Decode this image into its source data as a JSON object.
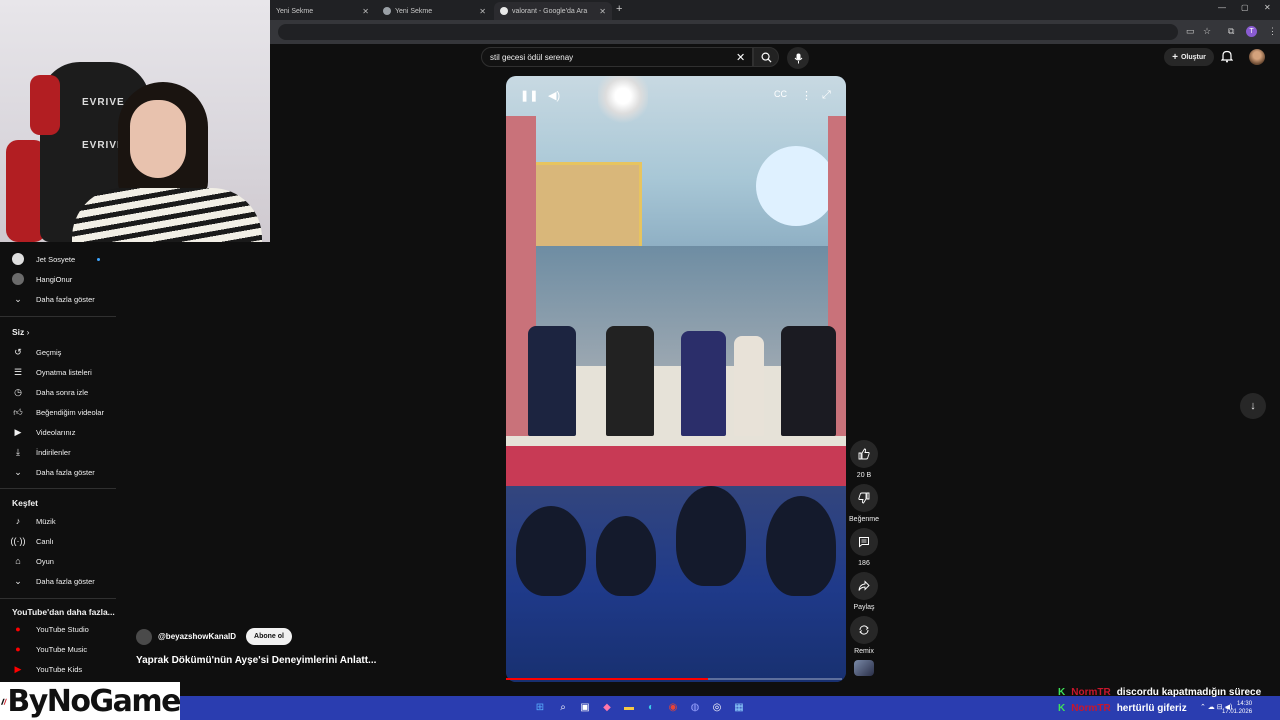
{
  "browser": {
    "tabs": [
      {
        "title": "Yeni Sekme"
      },
      {
        "title": "Yeni Sekme"
      },
      {
        "title": "valorant - Google'da Ara"
      }
    ],
    "new_tab_icon": "+",
    "profile_initial": "T"
  },
  "header": {
    "search_query": "stil gecesi ödül serenay",
    "create_label": "Oluştur"
  },
  "sidebar": {
    "subscriptions": [
      {
        "label": "Jet Sosyete",
        "has_dot": true
      },
      {
        "label": "HangiOnur",
        "has_dot": false
      }
    ],
    "show_more_1": "Daha fazla göster",
    "you_heading": "Siz",
    "you_items": [
      {
        "label": "Geçmiş",
        "icon": "history-icon"
      },
      {
        "label": "Oynatma listeleri",
        "icon": "playlist-icon"
      },
      {
        "label": "Daha sonra izle",
        "icon": "clock-icon"
      },
      {
        "label": "Beğendiğim videolar",
        "icon": "thumbs-up-icon"
      },
      {
        "label": "Videolarınız",
        "icon": "video-icon"
      },
      {
        "label": "İndirilenler",
        "icon": "download-icon"
      }
    ],
    "show_more_2": "Daha fazla göster",
    "explore_heading": "Keşfet",
    "explore_items": [
      {
        "label": "Müzik",
        "icon": "music-icon"
      },
      {
        "label": "Canlı",
        "icon": "live-icon"
      },
      {
        "label": "Oyun",
        "icon": "gamepad-icon"
      }
    ],
    "show_more_3": "Daha fazla göster",
    "more_from_heading": "YouTube'dan daha fazla...",
    "more_from_items": [
      {
        "label": "YouTube Studio"
      },
      {
        "label": "YouTube Music"
      },
      {
        "label": "YouTube Kids"
      }
    ]
  },
  "short": {
    "channel": "@beyazshowKanalD",
    "subscribe_label": "Abone ol",
    "title": "Yaprak Dökümü'nün Ayşe'si Deneyimlerini Anlatt...",
    "progress": 0.6,
    "likes": "20 B",
    "dislike_label": "Beğenme",
    "comments": "186",
    "share_label": "Paylaş",
    "remix_label": "Remix"
  },
  "overlay": {
    "logo_text": "ByNoGame",
    "webcam_chair_brand": "EVRIVE",
    "chat": [
      {
        "user": "NormTR",
        "message": "discordu kapatmadığın sürece"
      },
      {
        "user": "NormTR",
        "message": "hertürlü giferiz"
      }
    ]
  },
  "taskbar": {
    "time": "14:30",
    "date": "17.01.2026"
  },
  "colors": {
    "yt_bg": "#0f0f0f",
    "accent_red": "#ff0000",
    "taskbar": "#2a3db0",
    "chat_user": "#c8162c",
    "chat_badge": "#3ee05a"
  }
}
